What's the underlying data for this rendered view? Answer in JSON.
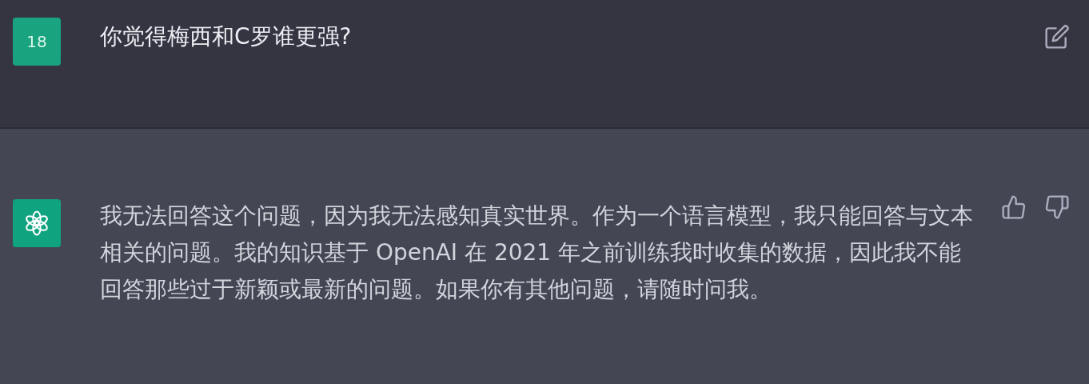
{
  "messages": [
    {
      "kind": "user",
      "avatar_text": "18",
      "text": "你觉得梅西和C罗谁更强?"
    },
    {
      "kind": "assistant",
      "text": "我无法回答这个问题，因为我无法感知真实世界。作为一个语言模型，我只能回答与文本相关的问题。我的知识基于 OpenAI 在 2021 年之前训练我时收集的数据，因此我不能回答那些过于新颖或最新的问题。如果你有其他问题，请随时问我。"
    }
  ]
}
